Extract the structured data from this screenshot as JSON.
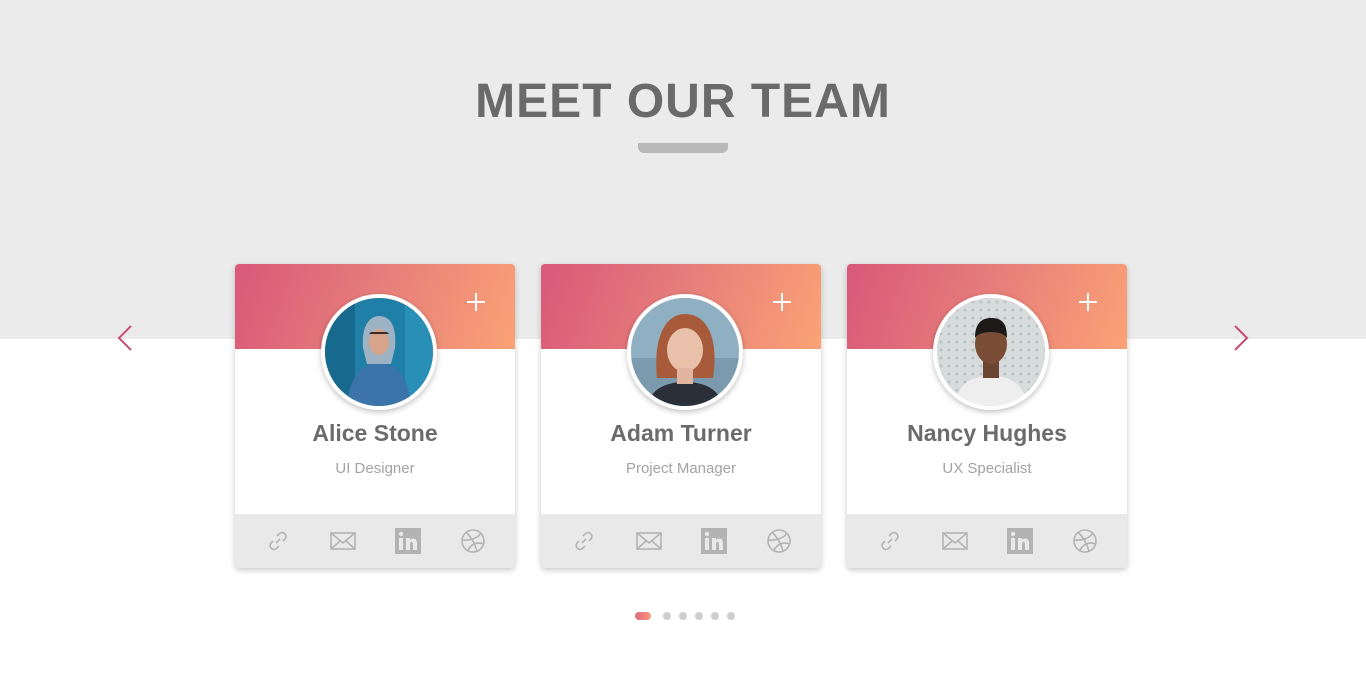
{
  "section": {
    "title": "MEET OUR TEAM"
  },
  "carousel": {
    "prev_icon": "chevron-left-icon",
    "next_icon": "chevron-right-icon",
    "dot_count": 6,
    "active_dot": 0
  },
  "team": [
    {
      "name": "Alice Stone",
      "role": "UI Designer"
    },
    {
      "name": "Adam Turner",
      "role": "Project Manager"
    },
    {
      "name": "Nancy Hughes",
      "role": "UX Specialist"
    }
  ],
  "social_icons": [
    "link-icon",
    "mail-icon",
    "linkedin-icon",
    "dribbble-icon"
  ],
  "colors": {
    "accent_start": "#d9587a",
    "accent_end": "#fba275",
    "arrow": "#c74d74",
    "title": "#6a6a6a"
  }
}
